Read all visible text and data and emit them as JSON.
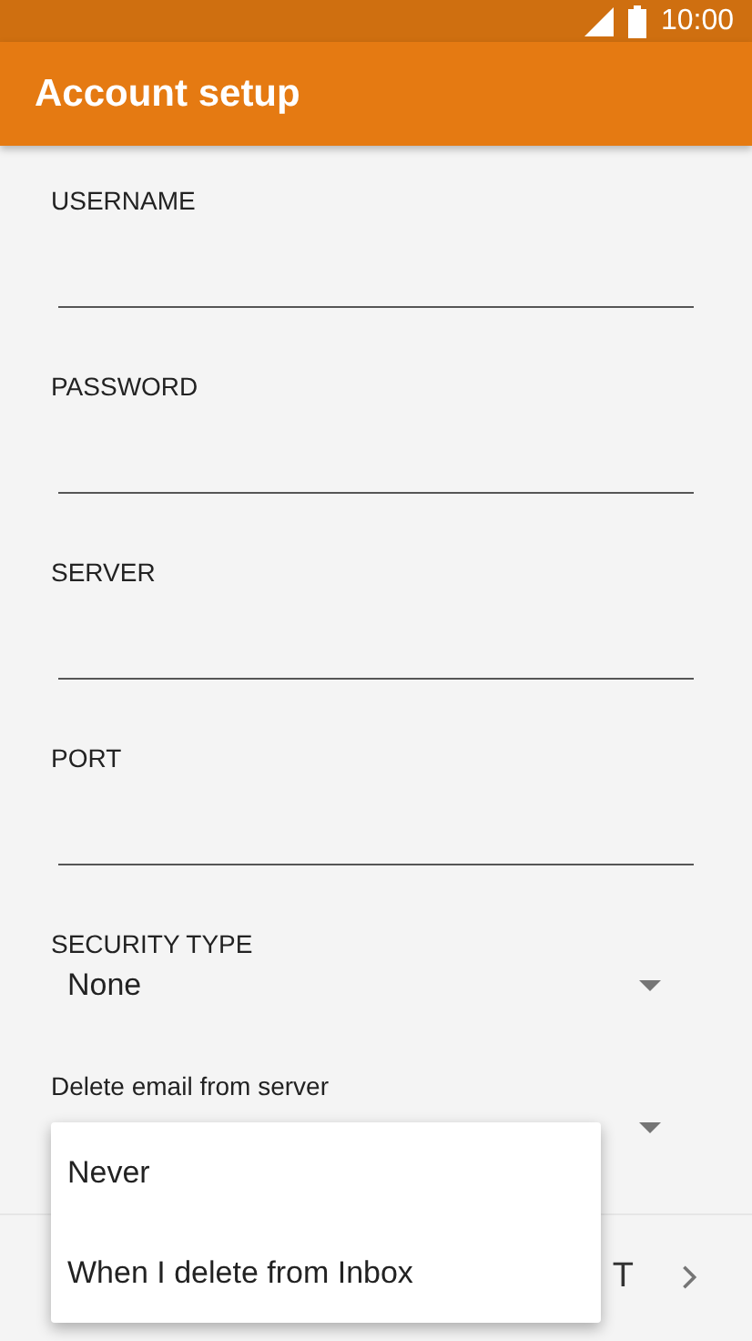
{
  "status_bar": {
    "time": "10:00"
  },
  "app_bar": {
    "title": "Account setup"
  },
  "fields": [
    {
      "label": "USERNAME"
    },
    {
      "label": "PASSWORD"
    },
    {
      "label": "SERVER"
    },
    {
      "label": "PORT"
    }
  ],
  "security_type": {
    "label": "SECURITY TYPE",
    "value": "None"
  },
  "delete_email": {
    "label": "Delete email from server"
  },
  "dropdown_menu": {
    "options": [
      {
        "label": "Never"
      },
      {
        "label": "When I delete from Inbox"
      }
    ]
  },
  "bottom_bar": {
    "next_button": "T"
  }
}
